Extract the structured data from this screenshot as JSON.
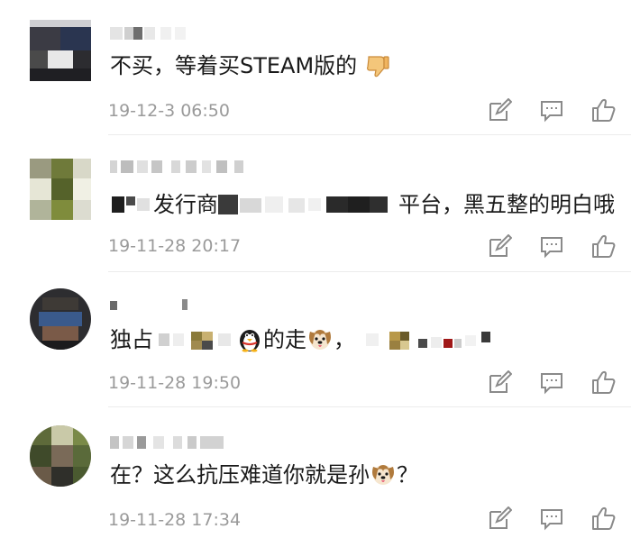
{
  "comments": [
    {
      "text_a": "不买，等着买STEAM版的",
      "emoji": "thumbs-down-emoji",
      "time": "19-12-3 06:50"
    },
    {
      "text_a": "发行商",
      "text_b": "平台，黑五整的明白哦",
      "time": "19-11-28 20:17"
    },
    {
      "text_a": "独占",
      "text_b": "的走",
      "text_c": "，",
      "emoji_a": "penguin-emoji",
      "emoji_b": "dog-emoji",
      "time": "19-11-28 19:50"
    },
    {
      "text_a": "在？这么抗压难道你就是孙",
      "text_b": "？",
      "emoji": "dog-emoji",
      "time": "19-11-28 17:34"
    }
  ],
  "icons": {
    "edit": "edit-icon",
    "reply": "comment-icon",
    "like": "thumbs-up-icon"
  },
  "colors": {
    "time": "#9a9a9a",
    "icon": "#8a8a8a",
    "divider": "#ececec"
  }
}
